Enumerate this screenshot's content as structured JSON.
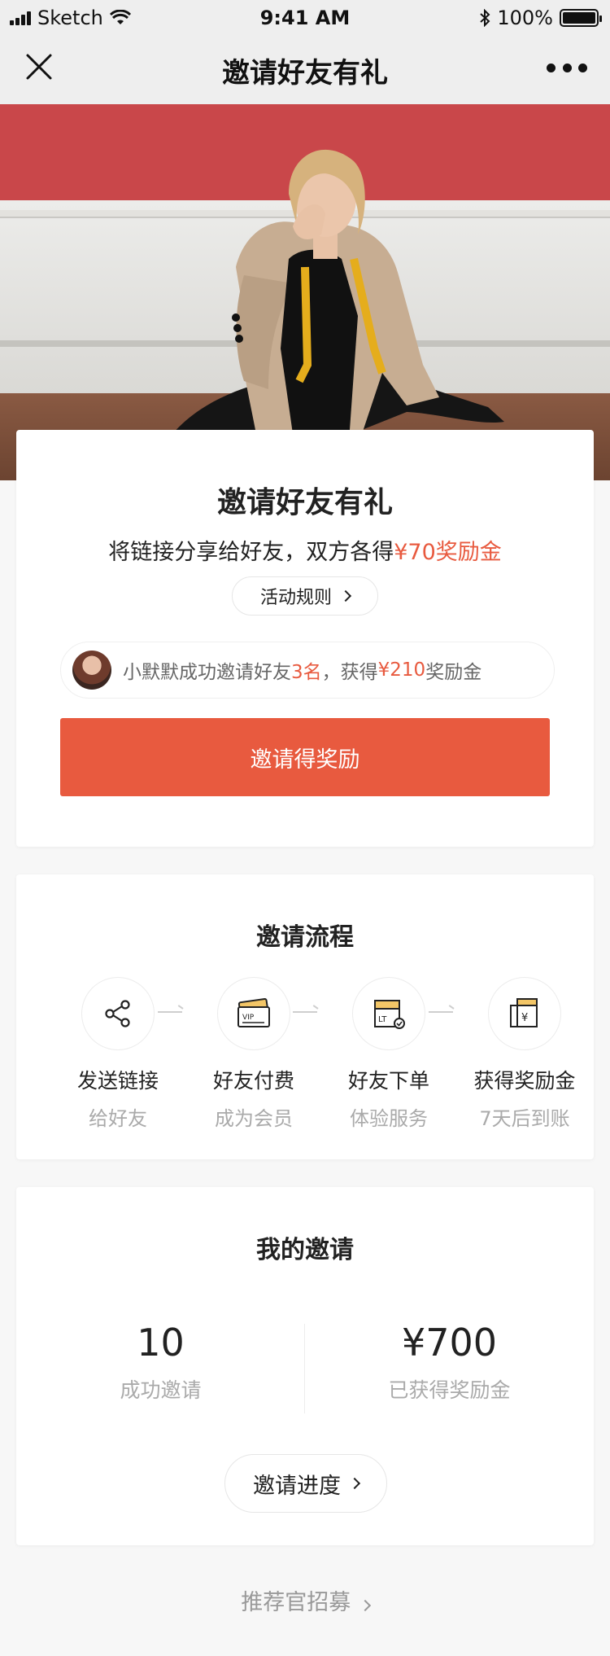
{
  "status_bar": {
    "carrier": "Sketch",
    "time": "9:41 AM",
    "battery": "100%"
  },
  "nav": {
    "title": "邀请好友有礼"
  },
  "invite_card": {
    "title": "邀请好友有礼",
    "subtitle_prefix": "将链接分享给好友，双方各得",
    "subtitle_highlight": "¥70奖励金",
    "rules_label": "活动规则",
    "notice": {
      "prefix": "小默默成功邀请好友",
      "count": "3名",
      "middle": "，获得",
      "amount": "¥210",
      "suffix": "奖励金"
    },
    "cta_label": "邀请得奖励"
  },
  "flow": {
    "title": "邀请流程",
    "steps": [
      {
        "icon": "share-icon",
        "title": "发送链接",
        "desc": "给好友"
      },
      {
        "icon": "vip-card-icon",
        "title": "好友付费",
        "desc": "成为会员"
      },
      {
        "icon": "package-icon",
        "title": "好友下单",
        "desc": "体验服务"
      },
      {
        "icon": "reward-envelope-icon",
        "title": "获得奖励金",
        "desc": "7天后到账"
      }
    ]
  },
  "my_invites": {
    "title": "我的邀请",
    "success_count": "10",
    "success_label": "成功邀请",
    "reward_amount": "¥700",
    "reward_label": "已获得奖励金",
    "progress_label": "邀请进度"
  },
  "footer": {
    "link_label": "推荐官招募"
  },
  "colors": {
    "accent": "#e85a3f",
    "hero_wall": "#c9474a"
  }
}
